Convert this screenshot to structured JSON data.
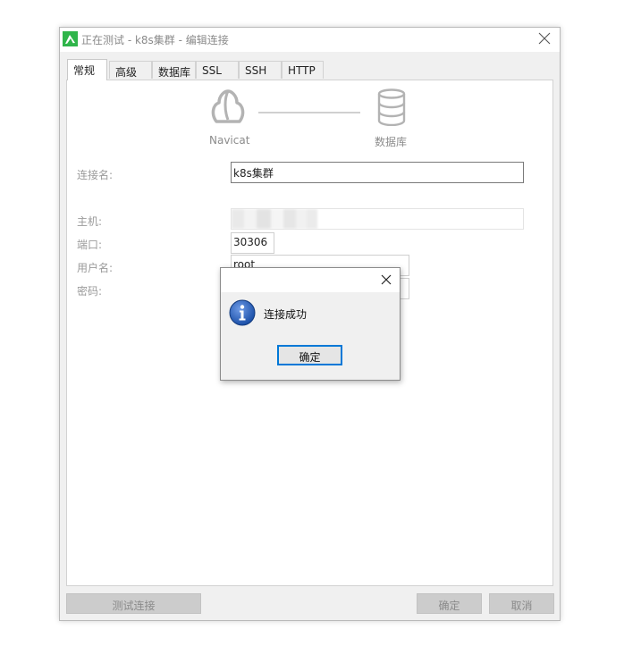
{
  "window": {
    "title": "正在测试 - k8s集群 - 编辑连接"
  },
  "tabs": [
    {
      "label": "常规"
    },
    {
      "label": "高级"
    },
    {
      "label": "数据库"
    },
    {
      "label": "SSL"
    },
    {
      "label": "SSH"
    },
    {
      "label": "HTTP"
    }
  ],
  "flow": {
    "source_label": "Navicat",
    "target_label": "数据库"
  },
  "form": {
    "connection_name_label": "连接名:",
    "connection_name_value": "k8s集群",
    "host_label": "主机:",
    "port_label": "端口:",
    "port_value": "30306",
    "user_label": "用户名:",
    "user_value": "root",
    "password_label": "密码:"
  },
  "footer": {
    "test_button": "测试连接",
    "ok_button": "确定",
    "cancel_button": "取消"
  },
  "dialog": {
    "message": "连接成功",
    "ok_button": "确定"
  },
  "colors": {
    "focus_border": "#0078d7",
    "info_blue": "#1a4fa8",
    "app_icon_green": "#2fb54a"
  }
}
